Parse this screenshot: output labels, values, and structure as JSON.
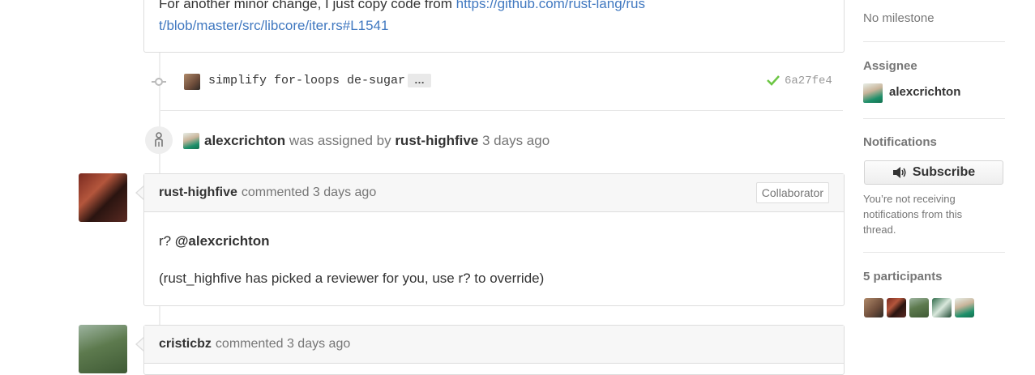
{
  "top_comment": {
    "text_before": "For another minor change, I just copy code from ",
    "link": "https://github.com/rust-lang/rust/blob/master/src/libcore/iter.rs#L1541"
  },
  "commit": {
    "message": "simplify for-loops de-sugar",
    "ellipsis": "…",
    "sha": "6a27fe4"
  },
  "assign_event": {
    "assignee": "alexcrichton",
    "middle": "was assigned by",
    "assigner": "rust-highfive",
    "time": "3 days ago"
  },
  "comment1": {
    "author": "rust-highfive",
    "action": "commented 3 days ago",
    "badge": "Collaborator",
    "line1_prefix": "r? ",
    "mention": "@alexcrichton",
    "line2": "(rust_highfive has picked a reviewer for you, use r? to override)"
  },
  "comment2": {
    "author": "cristicbz",
    "action": "commented 3 days ago"
  },
  "sidebar": {
    "milestone": "No milestone",
    "assignee_title": "Assignee",
    "assignee_name": "alexcrichton",
    "notifications_title": "Notifications",
    "subscribe_label": "Subscribe",
    "notifications_note": "You’re not receiving notifications from this thread.",
    "participants_title": "5 participants"
  },
  "colors": {
    "link": "#4078c0",
    "check": "#6cc644"
  }
}
